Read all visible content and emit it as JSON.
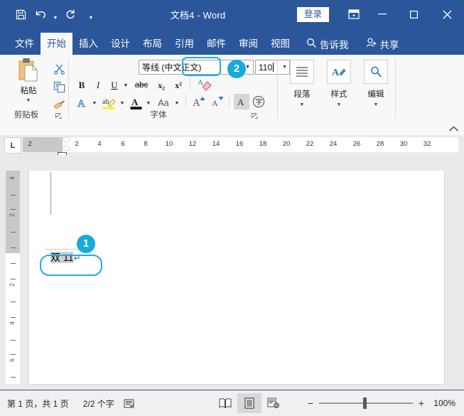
{
  "window": {
    "title": "文档4 - Word",
    "signin_label": "登录",
    "quick_access": [
      {
        "name": "save-icon",
        "label": "保存"
      },
      {
        "name": "undo-icon",
        "label": "撤消"
      },
      {
        "name": "redo-icon",
        "label": "恢复"
      },
      {
        "name": "customize-qat-icon",
        "label": "自定义快速访问工具栏"
      }
    ],
    "controls": [
      {
        "name": "ribbon-display-options-icon",
        "label": "功能区显示选项"
      },
      {
        "name": "minimize-icon",
        "label": "最小化"
      },
      {
        "name": "maximize-icon",
        "label": "最大化"
      },
      {
        "name": "close-icon",
        "label": "关闭"
      }
    ]
  },
  "tabs": [
    {
      "label": "文件",
      "active": false
    },
    {
      "label": "开始",
      "active": true
    },
    {
      "label": "插入",
      "active": false
    },
    {
      "label": "设计",
      "active": false
    },
    {
      "label": "布局",
      "active": false
    },
    {
      "label": "引用",
      "active": false
    },
    {
      "label": "邮件",
      "active": false
    },
    {
      "label": "审阅",
      "active": false
    },
    {
      "label": "视图",
      "active": false
    }
  ],
  "tellme": {
    "label": "告诉我",
    "icon": "search-icon"
  },
  "share": {
    "label": "共享",
    "icon": "person-add-icon"
  },
  "ribbon": {
    "clipboard": {
      "group_label": "剪贴板",
      "paste_label": "粘贴",
      "cut_label": "剪切",
      "copy_label": "复制",
      "format_painter_label": "格式刷"
    },
    "font": {
      "group_label": "字体",
      "font_name": "等线 (中文正文)",
      "font_size": "110",
      "bold": "B",
      "italic": "I",
      "underline": "U",
      "strikethrough": "abc",
      "subscript": "x₂",
      "superscript": "x²",
      "clear_format_label": "清除所有格式",
      "text_effects_label": "文本效果和版式",
      "highlight_label": "以不同颜色突出显示文本",
      "font_color_label": "字体颜色",
      "change_case": "Aa",
      "grow_font": "A",
      "shrink_font": "A",
      "char_shading_label": "字符底纹",
      "enclose_char_label": "带圈字符"
    },
    "paragraph": {
      "label": "段落",
      "icon": "paragraph-icon"
    },
    "styles": {
      "label": "样式",
      "icon": "styles-icon"
    },
    "editing": {
      "label": "编辑",
      "icon": "editing-icon"
    },
    "collapse_label": "折叠功能区"
  },
  "ruler": {
    "tab_stop_marker": "L",
    "horizontal_numbers": [
      "2",
      "2",
      "4",
      "6",
      "8",
      "10",
      "12",
      "14",
      "16",
      "18",
      "20",
      "22",
      "24",
      "26",
      "28",
      "30",
      "32"
    ],
    "vertical_numbers": [
      "4",
      "2",
      "2",
      "4",
      "6"
    ]
  },
  "document": {
    "text": "双 11",
    "paragraph_mark": "↵"
  },
  "annotations": [
    {
      "number": "1",
      "target": "document-text-box"
    },
    {
      "number": "2",
      "target": "font-size-box"
    }
  ],
  "status": {
    "page_info": "第 1 页，共 1 页",
    "word_count": "2/2 个字",
    "proofing_icon": "proofing-icon",
    "views": [
      {
        "name": "read-mode-icon",
        "label": "阅读视图",
        "active": false
      },
      {
        "name": "print-layout-icon",
        "label": "页面视图",
        "active": true
      },
      {
        "name": "web-layout-icon",
        "label": "Web 版式视图",
        "active": false
      }
    ],
    "zoom_out": "−",
    "zoom_in": "+",
    "zoom_level": "100%"
  },
  "colors": {
    "titlebar": "#2b579a",
    "ribbon_bg": "#f8f8f8",
    "accent_annotation": "#16aadd",
    "doc_bg": "#eaeaea"
  }
}
